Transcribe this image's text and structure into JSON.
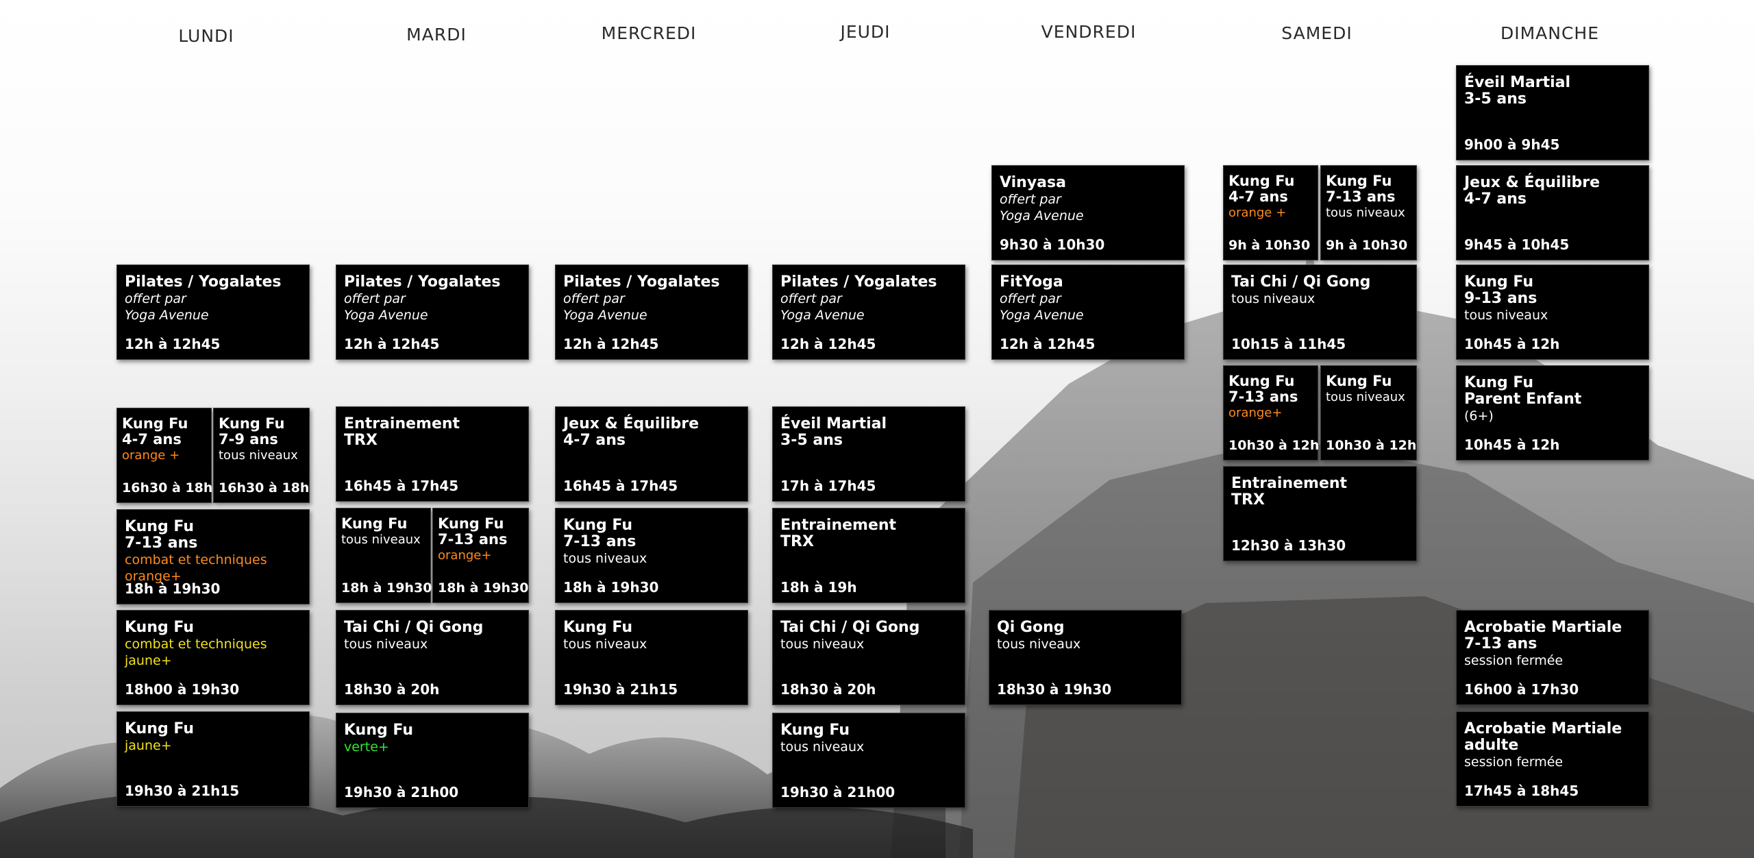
{
  "days": [
    "LUNDI",
    "MARDI",
    "MERCREDI",
    "JEUDI",
    "VENDREDI",
    "SAMEDI",
    "DIMANCHE"
  ],
  "colors": {
    "orange": "#ff8a1f",
    "yellow": "#f2e21c",
    "green": "#33e82e",
    "subtitle": "#ffffff"
  },
  "classes": [
    {
      "title": "Pilates / Yogalates",
      "lines": [
        {
          "text": "offert par\nYoga Avenue",
          "italic": true
        }
      ],
      "time": "12h à 12h45"
    },
    {
      "title": "Kung Fu\n4-7 ans",
      "lines": [
        {
          "text": "orange +",
          "color": "orange"
        }
      ],
      "time": "16h30 à 18h"
    },
    {
      "title": "Kung Fu\n7-9 ans",
      "lines": [
        {
          "text": "tous niveaux"
        }
      ],
      "time": "16h30 à 18h"
    },
    {
      "title": "Kung Fu\n7-13 ans",
      "lines": [
        {
          "text": "combat et techniques\norange+",
          "color": "orange"
        }
      ],
      "time": "18h à 19h30"
    },
    {
      "title": "Kung Fu",
      "lines": [
        {
          "text": "combat et techniques\njaune+",
          "color": "yellow"
        }
      ],
      "time": "18h00 à 19h30"
    },
    {
      "title": "Kung Fu",
      "lines": [
        {
          "text": "jaune+",
          "color": "yellow"
        }
      ],
      "time": "19h30 à 21h15"
    },
    {
      "title": "Pilates / Yogalates",
      "lines": [
        {
          "text": "offert par\nYoga Avenue",
          "italic": true
        }
      ],
      "time": "12h à 12h45"
    },
    {
      "title": "Entrainement\nTRX",
      "lines": [],
      "time": "16h45 à 17h45"
    },
    {
      "title": "Kung Fu",
      "lines": [
        {
          "text": "tous niveaux"
        }
      ],
      "time": "18h à 19h30"
    },
    {
      "title": "Kung Fu\n7-13 ans",
      "lines": [
        {
          "text": "orange+",
          "color": "orange"
        }
      ],
      "time": "18h à 19h30"
    },
    {
      "title": "Tai Chi / Qi Gong",
      "lines": [
        {
          "text": "tous niveaux"
        }
      ],
      "time": "18h30 à 20h"
    },
    {
      "title": "Kung Fu",
      "lines": [
        {
          "text": "verte+",
          "color": "green"
        }
      ],
      "time": "19h30 à 21h00"
    },
    {
      "title": "Pilates / Yogalates",
      "lines": [
        {
          "text": "offert par\nYoga Avenue",
          "italic": true
        }
      ],
      "time": "12h à 12h45"
    },
    {
      "title": "Jeux & Équilibre\n4-7 ans",
      "lines": [],
      "time": "16h45 à 17h45"
    },
    {
      "title": "Kung Fu\n7-13 ans",
      "lines": [
        {
          "text": "tous niveaux"
        }
      ],
      "time": "18h à 19h30"
    },
    {
      "title": "Kung Fu",
      "lines": [
        {
          "text": "tous niveaux"
        }
      ],
      "time": "19h30 à 21h15"
    },
    {
      "title": "Pilates / Yogalates",
      "lines": [
        {
          "text": "offert par\nYoga Avenue",
          "italic": true
        }
      ],
      "time": "12h à 12h45"
    },
    {
      "title": "Éveil Martial\n3-5 ans",
      "lines": [],
      "time": "17h à 17h45"
    },
    {
      "title": "Entrainement\nTRX",
      "lines": [],
      "time": "18h à 19h"
    },
    {
      "title": "Tai Chi / Qi Gong",
      "lines": [
        {
          "text": "tous niveaux"
        }
      ],
      "time": "18h30 à 20h"
    },
    {
      "title": "Kung Fu",
      "lines": [
        {
          "text": "tous niveaux"
        }
      ],
      "time": "19h30 à 21h00"
    },
    {
      "title": "Vinyasa",
      "lines": [
        {
          "text": "offert par\nYoga Avenue",
          "italic": true
        }
      ],
      "time": "9h30 à 10h30"
    },
    {
      "title": "FitYoga",
      "lines": [
        {
          "text": "offert par\nYoga Avenue",
          "italic": true
        }
      ],
      "time": "12h à 12h45"
    },
    {
      "title": "Qi Gong",
      "lines": [
        {
          "text": "tous niveaux"
        }
      ],
      "time": "18h30 à 19h30"
    },
    {
      "title": "Kung Fu\n4-7 ans",
      "lines": [
        {
          "text": "orange +",
          "color": "orange"
        }
      ],
      "time": "9h à 10h30"
    },
    {
      "title": "Kung Fu\n7-13 ans",
      "lines": [
        {
          "text": "tous niveaux"
        }
      ],
      "time": "9h à 10h30"
    },
    {
      "title": "Tai Chi / Qi Gong",
      "lines": [
        {
          "text": "tous niveaux"
        }
      ],
      "time": "10h15 à 11h45"
    },
    {
      "title": "Kung Fu\n7-13 ans",
      "lines": [
        {
          "text": "orange+",
          "color": "orange"
        }
      ],
      "time": "10h30 à 12h"
    },
    {
      "title": "Kung Fu",
      "lines": [
        {
          "text": "tous niveaux"
        }
      ],
      "time": "10h30 à 12h"
    },
    {
      "title": "Entrainement\nTRX",
      "lines": [],
      "time": "12h30 à 13h30"
    },
    {
      "title": "Éveil Martial\n3-5 ans",
      "lines": [],
      "time": "9h00 à 9h45"
    },
    {
      "title": "Jeux & Équilibre\n4-7 ans",
      "lines": [],
      "time": "9h45 à 10h45"
    },
    {
      "title": "Kung Fu\n9-13 ans",
      "lines": [
        {
          "text": "tous niveaux"
        }
      ],
      "time": "10h45 à 12h"
    },
    {
      "title": "Kung Fu\nParent Enfant",
      "lines": [
        {
          "text": "(6+)"
        }
      ],
      "time": "10h45 à 12h"
    },
    {
      "title": "Acrobatie Martiale\n7-13 ans",
      "lines": [
        {
          "text": "session fermée"
        }
      ],
      "time": "16h00 à 17h30"
    },
    {
      "title": "Acrobatie Martiale\nadulte",
      "lines": [
        {
          "text": "session fermée"
        }
      ],
      "time": "17h45 à 18h45"
    }
  ]
}
